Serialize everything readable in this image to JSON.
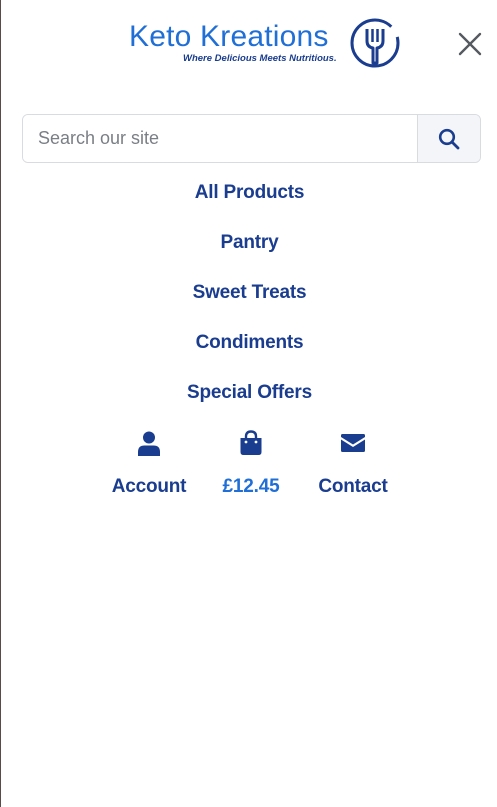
{
  "brand": {
    "name": "Keto Kreations",
    "tagline": "Where Delicious Meets Nutritious.",
    "logo_icon": "fork-in-circle-icon",
    "primary_color": "#1f6fd6",
    "dark_color": "#1a3d8f"
  },
  "header": {
    "close_icon": "close-icon"
  },
  "search": {
    "placeholder": "Search our site",
    "value": "",
    "button_icon": "search-icon"
  },
  "nav": {
    "items": [
      {
        "label": "All Products"
      },
      {
        "label": "Pantry"
      },
      {
        "label": "Sweet Treats"
      },
      {
        "label": "Condiments"
      },
      {
        "label": "Special Offers"
      }
    ]
  },
  "quick_links": {
    "account": {
      "label": "Account",
      "icon": "user-icon"
    },
    "basket": {
      "label": "£12.45",
      "icon": "shopping-bag-icon"
    },
    "contact": {
      "label": "Contact",
      "icon": "envelope-icon"
    }
  }
}
